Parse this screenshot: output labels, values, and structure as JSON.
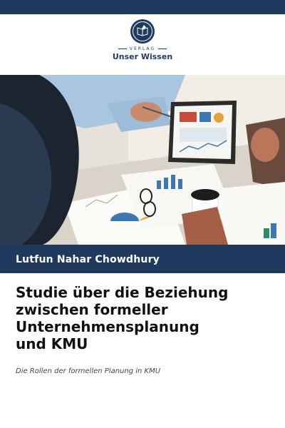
{
  "publisher": {
    "verlag_label": "VERLAG",
    "name": "Unser Wissen",
    "emblem_icon": "book-emblem-icon"
  },
  "cover_image": {
    "description_icon": "business-meeting-photo"
  },
  "author": {
    "name": "Lutfun Nahar Chowdhury"
  },
  "book": {
    "title_lines": [
      "Studie über die Beziehung",
      "zwischen formeller",
      "Unternehmensplanung",
      "und KMU"
    ],
    "subtitle": "Die Rollen der formellen Planung in KMU"
  },
  "colors": {
    "brand": "#1f3a5c",
    "background": "#ffffff"
  }
}
